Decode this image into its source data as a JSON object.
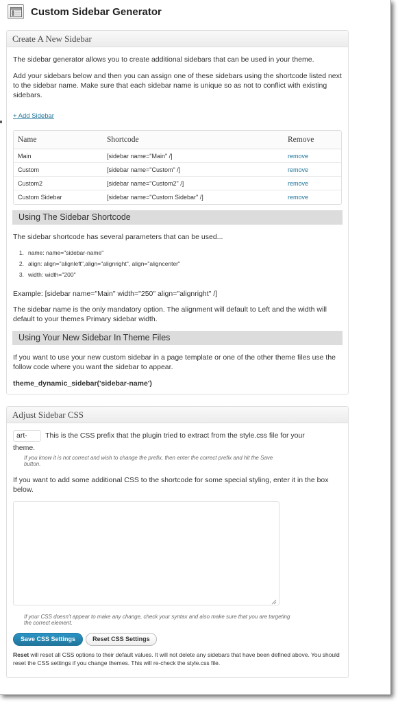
{
  "header": {
    "title": "Custom Sidebar Generator",
    "icon": "sidebar-layout-icon"
  },
  "create_box": {
    "title": "Create A New Sidebar",
    "intro": "The sidebar generator allows you to create additional sidebars that can be used in your theme.",
    "instructions": "Add your sidebars below and then you can assign one of these sidebars using the shortcode listed next to the sidebar name. Make sure that each sidebar name is unique so as not to conflict with existing sidebars.",
    "add_link": "+ Add Sidebar",
    "table": {
      "headers": [
        "Name",
        "Shortcode",
        "Remove"
      ],
      "rows": [
        {
          "name": "Main",
          "shortcode": "[sidebar name=\"Main\" /]",
          "remove": "remove"
        },
        {
          "name": "Custom",
          "shortcode": "[sidebar name=\"Custom\" /]",
          "remove": "remove"
        },
        {
          "name": "Custom2",
          "shortcode": "[sidebar name=\"Custom2\" /]",
          "remove": "remove"
        },
        {
          "name": "Custom Sidebar",
          "shortcode": "[sidebar name=\"Custom Sidebar\" /]",
          "remove": "remove"
        }
      ]
    },
    "shortcode_section": {
      "heading": "Using The Sidebar Shortcode",
      "intro": "The sidebar shortcode has several parameters that can be used...",
      "params": [
        {
          "num": "1.",
          "text": "name: name=\"sidebar-name\""
        },
        {
          "num": "2.",
          "text": "align: align=\"alignleft\",align=\"alignright\", align=\"aligncenter\""
        },
        {
          "num": "3.",
          "text": "width: width=\"200\""
        }
      ],
      "example": "Example: [sidebar name=\"Main\" width=\"250\" align=\"alignright\" /]",
      "note": "The sidebar name is the only mandatory option. The alignment will default to Left and the width will default to your themes Primary sidebar width."
    },
    "theme_section": {
      "heading": "Using Your New Sidebar In Theme Files",
      "text": "If you want to use your new custom sidebar in a page template or one of the other theme files use the follow code where you want the sidebar to appear.",
      "code": "theme_dynamic_sidebar('sidebar-name')"
    }
  },
  "css_box": {
    "title": "Adjust Sidebar CSS",
    "prefix_value": "art-",
    "prefix_text_1": "This is the CSS prefix that the plugin tried to extract from the style.css file for your",
    "prefix_text_2": "theme.",
    "prefix_note_1": "If you know it is not correct and wish to change the prefix, then enter the correct prefix and hit the Save",
    "prefix_note_2": "button.",
    "css_intro": "If you want to add some additional CSS to the shortcode for some special styling, enter it in the box below.",
    "css_value": "",
    "css_note_1": "If your CSS doesn't appear to make any change, check your syntax and also make sure that you are targeting",
    "css_note_2": "the correct element.",
    "save_label": "Save CSS Settings",
    "reset_label": "Reset CSS Settings",
    "reset_bold": "Reset",
    "reset_text": " will reset all CSS options to their default values. It will not delete any sidebars that have been defined above. You should reset the CSS settings if you change themes. This will re-check the style.css file."
  },
  "colors": {
    "link": "#21759b",
    "section_bar": "#dcdcdc",
    "primary_button": "#21759b"
  }
}
